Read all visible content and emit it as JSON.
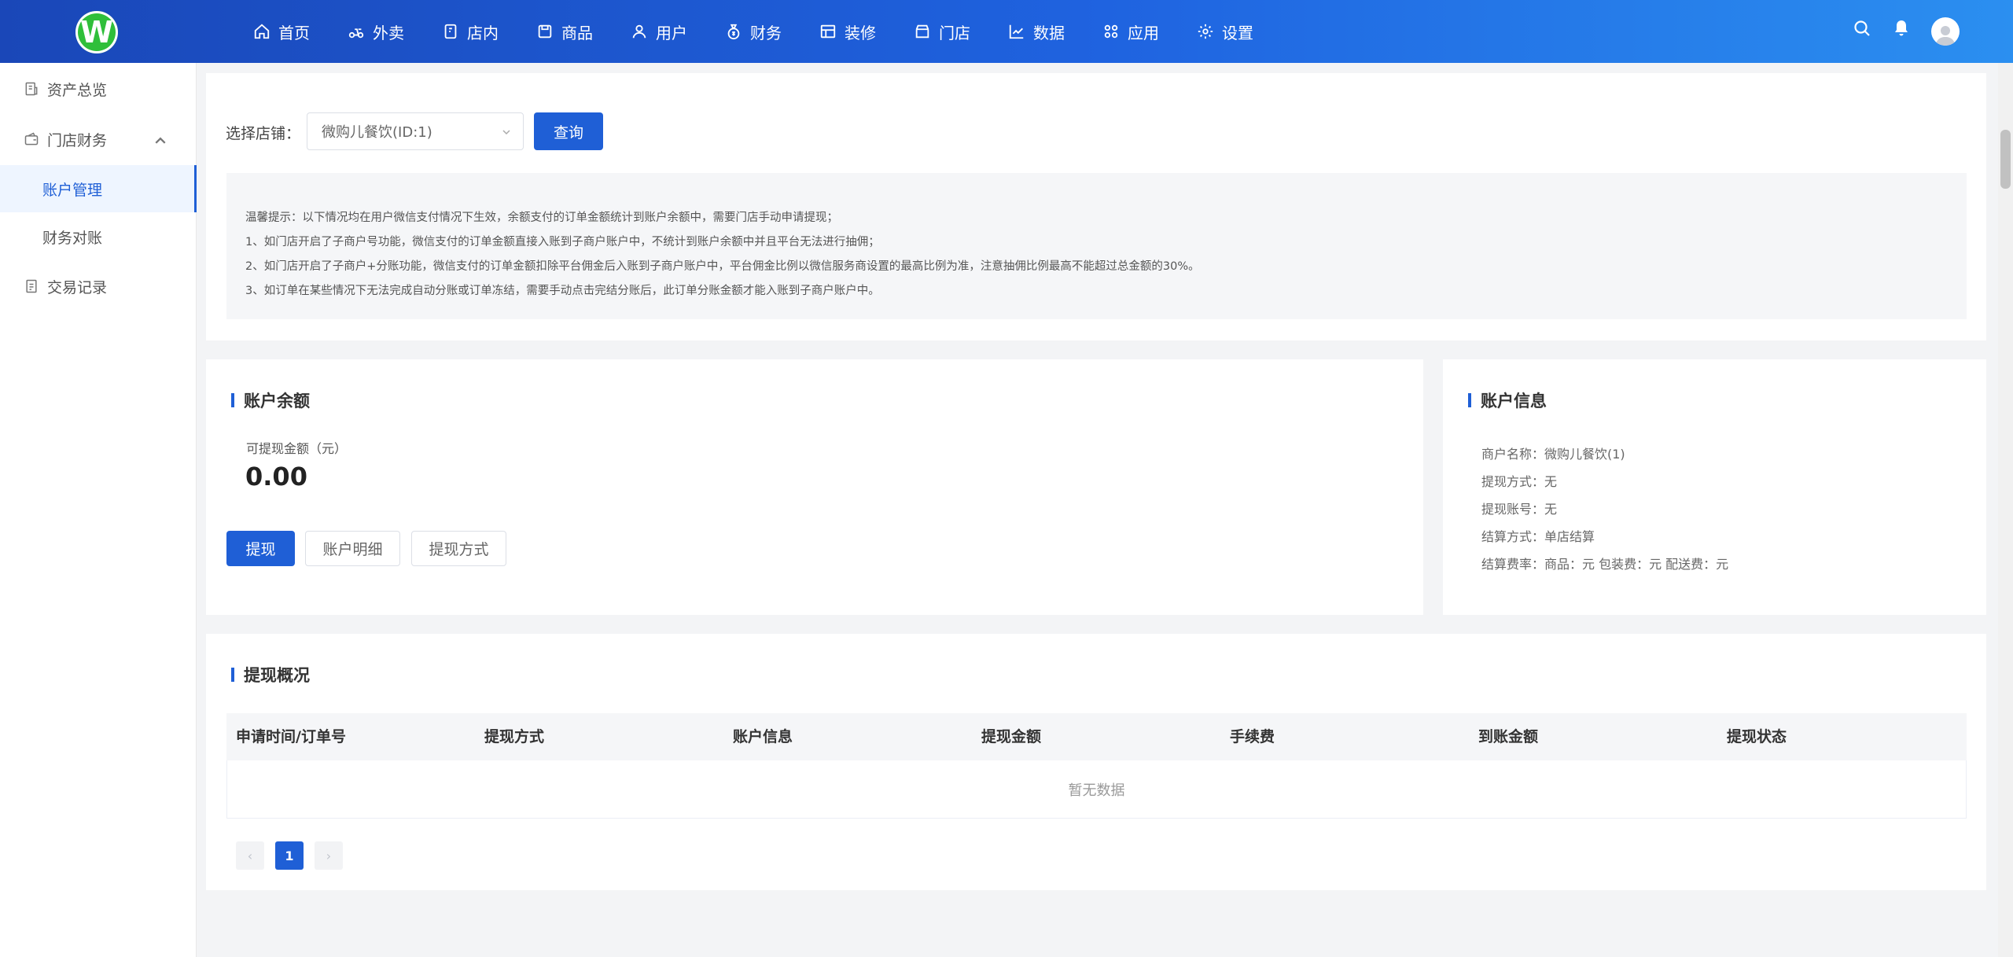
{
  "logo": {
    "letter": "W"
  },
  "nav": [
    {
      "label": "首页",
      "icon": "home-icon"
    },
    {
      "label": "外卖",
      "icon": "scooter-icon"
    },
    {
      "label": "店内",
      "icon": "dine-in-icon"
    },
    {
      "label": "商品",
      "icon": "goods-icon"
    },
    {
      "label": "用户",
      "icon": "user-icon"
    },
    {
      "label": "财务",
      "icon": "money-bag-icon"
    },
    {
      "label": "装修",
      "icon": "decorate-icon"
    },
    {
      "label": "门店",
      "icon": "store-icon"
    },
    {
      "label": "数据",
      "icon": "chart-icon"
    },
    {
      "label": "应用",
      "icon": "apps-icon"
    },
    {
      "label": "设置",
      "icon": "gear-icon"
    }
  ],
  "sidebar": {
    "asset_overview": "资产总览",
    "store_finance": "门店财务",
    "account_management": "账户管理",
    "finance_reconciliation": "财务对账",
    "transaction_records": "交易记录"
  },
  "filter": {
    "store_label": "选择店铺：",
    "store_value": "微购儿餐饮(ID:1)",
    "query_button": "查询"
  },
  "tips": [
    "温馨提示：以下情况均在用户微信支付情况下生效，余额支付的订单金额统计到账户余额中，需要门店手动申请提现；",
    "1、如门店开启了子商户号功能，微信支付的订单金额直接入账到子商户账户中，不统计到账户余额中并且平台无法进行抽佣；",
    "2、如门店开启了子商户+分账功能，微信支付的订单金额扣除平台佣金后入账到子商户账户中，平台佣金比例以微信服务商设置的最高比例为准，注意抽佣比例最高不能超过总金额的30%。",
    "3、如订单在某些情况下无法完成自动分账或订单冻结，需要手动点击完结分账后，此订单分账金额才能入账到子商户账户中。"
  ],
  "balance": {
    "title": "账户余额",
    "withdrawable_label": "可提现金额（元）",
    "amount": "0.00",
    "withdraw_button": "提现",
    "details_button": "账户明细",
    "method_button": "提现方式"
  },
  "account_info": {
    "title": "账户信息",
    "lines": [
      "商户名称：微购儿餐饮(1)",
      "提现方式：无",
      "提现账号：无",
      "结算方式：单店结算",
      "结算费率：商品：元 包装费：元 配送费：元"
    ]
  },
  "withdrawal": {
    "title": "提现概况",
    "columns": [
      "申请时间/订单号",
      "提现方式",
      "账户信息",
      "提现金额",
      "手续费",
      "到账金额",
      "提现状态"
    ],
    "empty_text": "暂无数据",
    "pagination": {
      "prev": "‹",
      "current": "1",
      "next": "›"
    }
  },
  "colors": {
    "primary": "#1f5fd6",
    "header_start": "#1a47b8",
    "header_end": "#2b8ff0",
    "logo_green": "#2fbf3a"
  }
}
